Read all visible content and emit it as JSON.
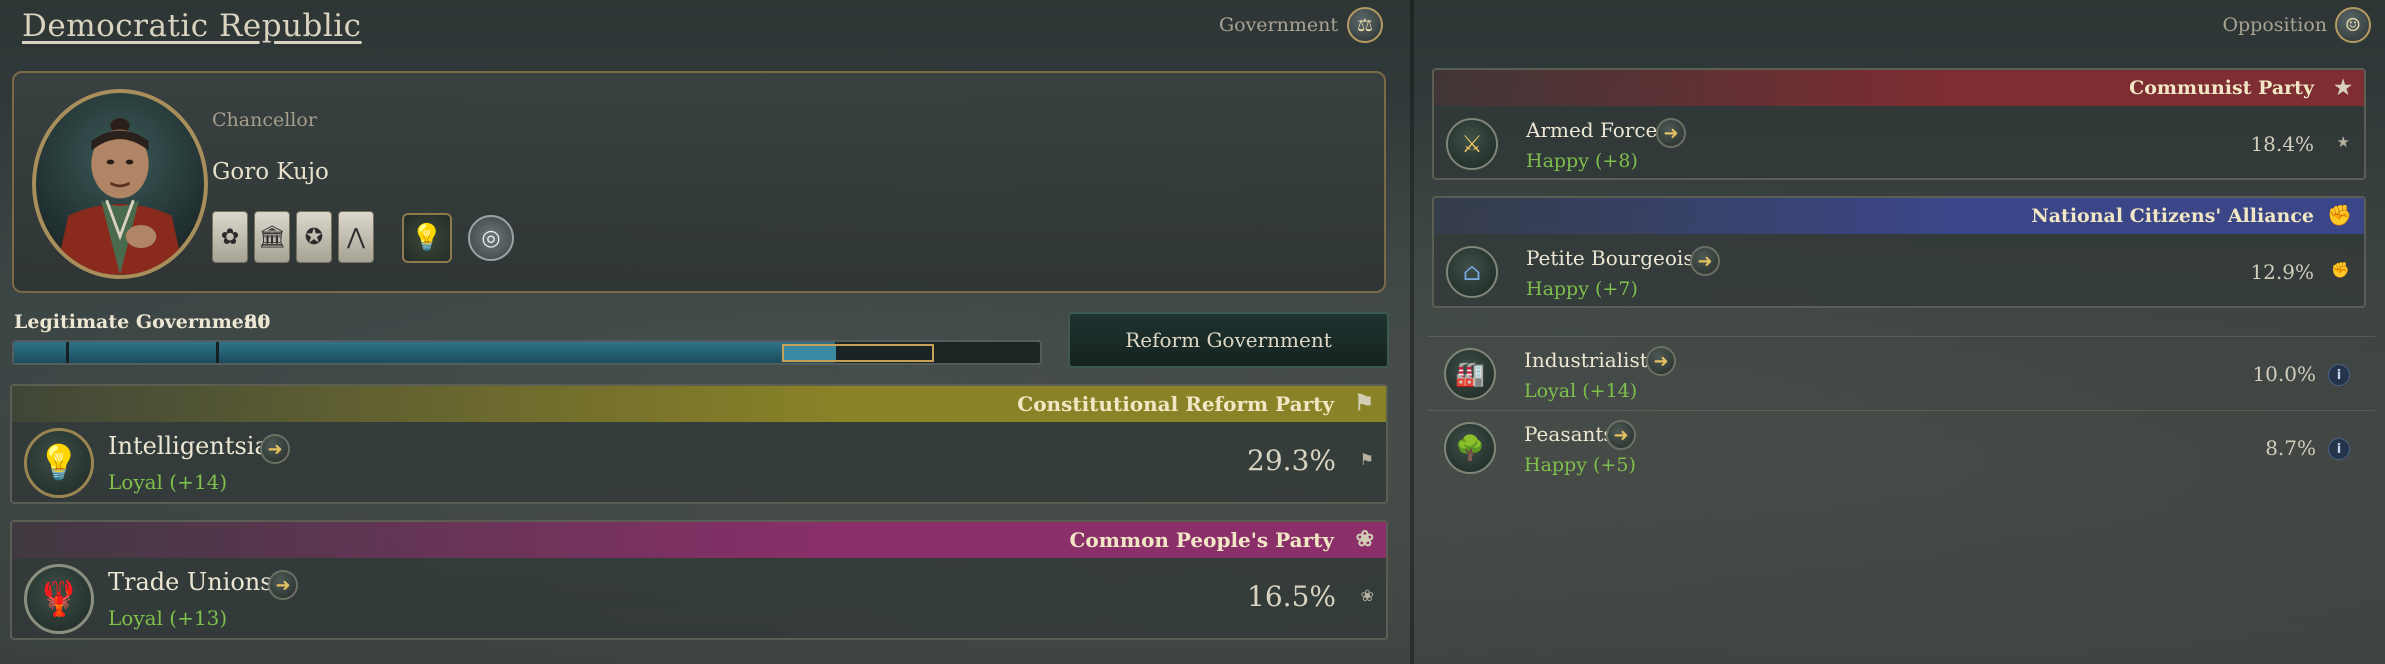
{
  "government": {
    "title": "Democratic Republic",
    "label": "Government",
    "label_icon": "statesman-icon",
    "leader": {
      "role": "Chancellor",
      "name": "Goro Kujo",
      "traits": [
        "rose-trait-icon",
        "institution-trait-icon",
        "military-rank-icon",
        "chevron-rank-icon"
      ],
      "interest_group_badge": "lightbulb-icon",
      "ideology_badge": "globe-icon"
    },
    "legitimacy": {
      "label": "Legitimate Government",
      "value": "80",
      "fraction": 0.8
    },
    "reform_button": "Reform Government",
    "parties": [
      {
        "name": "Constitutional Reform Party",
        "band_color": "#8a8227",
        "icon": "flag-icon",
        "interest_group": {
          "name": "Intelligentsia",
          "icon": "lightbulb-icon",
          "approval": "Loyal",
          "approval_value": "+14",
          "clout": "29.3%"
        }
      },
      {
        "name": "Common People's Party",
        "band_color": "#8a2f6a",
        "icon": "rose-icon",
        "interest_group": {
          "name": "Trade Unions",
          "icon": "lobster-icon",
          "approval": "Loyal",
          "approval_value": "+13",
          "clout": "16.5%"
        }
      }
    ]
  },
  "opposition": {
    "label": "Opposition",
    "label_icon": "opposition-figure-icon",
    "parties": [
      {
        "name": "Communist Party",
        "band_color": "#7e2d32",
        "icon": "star-icon",
        "interest_group": {
          "name": "Armed Forces",
          "icon": "crossed-swords-icon",
          "approval": "Happy",
          "approval_value": "+8",
          "clout": "18.4%"
        }
      },
      {
        "name": "National Citizens' Alliance",
        "band_color": "#3b4688",
        "icon": "fist-icon",
        "interest_group": {
          "name": "Petite Bourgeoisie",
          "icon": "houses-icon",
          "approval": "Happy",
          "approval_value": "+7",
          "clout": "12.9%"
        }
      }
    ],
    "independents": [
      {
        "name": "Industrialists",
        "icon": "factory-icon",
        "approval": "Loyal",
        "approval_value": "+14",
        "clout": "10.0%"
      },
      {
        "name": "Peasants",
        "icon": "tree-icon",
        "approval": "Happy",
        "approval_value": "+5",
        "clout": "8.7%"
      }
    ]
  }
}
